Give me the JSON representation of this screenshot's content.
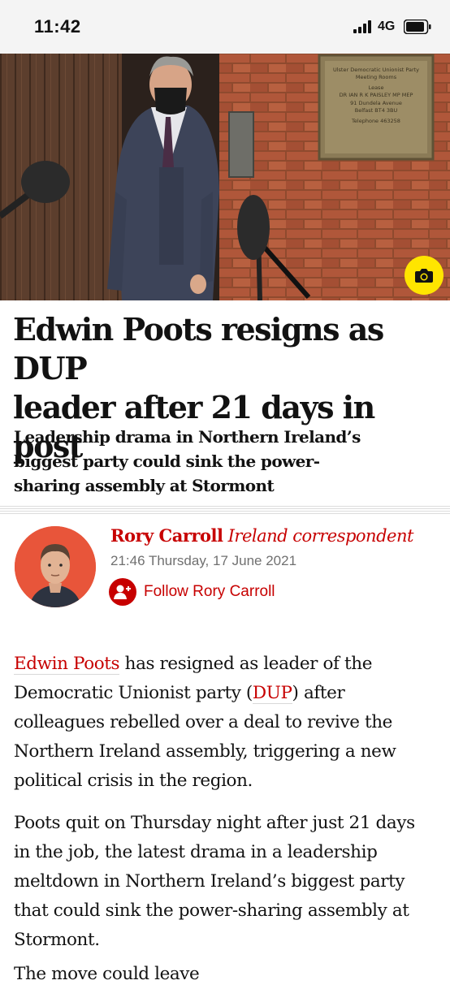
{
  "status_bar": {
    "time": "11:42",
    "network": "4G"
  },
  "hero": {
    "plaque_lines": [
      "Ulster Democratic Unionist Party",
      "Meeting Rooms",
      "Lease",
      "DR IAN R K PAISLEY MP MEP",
      "91 Dundela Avenue",
      "Belfast BT4 3BU",
      "Telephone 463258"
    ]
  },
  "article": {
    "headline_line1": "Edwin Poots resigns as DUP",
    "headline_line2": "leader after 21 days in post",
    "standfirst_line1": "Leadership drama in Northern Ireland’s",
    "standfirst_line2": "biggest party could sink the power-",
    "standfirst_line3": "sharing assembly at Stormont"
  },
  "byline": {
    "author": "Rory Carroll",
    "role": "Ireland correspondent",
    "dateline": "21:46 Thursday, 17 June 2021",
    "follow_label": "Follow Rory Carroll"
  },
  "body": {
    "p1_link1": "Edwin Poots",
    "p1_line1_rest": " has resigned as leader of the",
    "p1_line2_start": "Democratic Unionist party (",
    "p1_link2": "DUP",
    "p1_line2_end": ") after",
    "p1_line3": "colleagues rebelled over a deal to revive the",
    "p1_line4": "Northern Ireland assembly, triggering a new",
    "p1_line5": "political crisis in the region.",
    "p2_line1": "Poots quit on Thursday night after just 21 days",
    "p2_line2": "in the job, the latest drama in a leadership",
    "p2_line3": "meltdown in Northern Ireland’s biggest party",
    "p2_line4": "that could sink the power-sharing assembly at",
    "p2_line5": "Stormont.",
    "p3_line1": "The move could leave"
  },
  "colors": {
    "accent": "#c70000",
    "camera_button": "#ffe500",
    "avatar_bg": "#e8553a"
  },
  "icons": [
    "signal-icon",
    "battery-icon",
    "camera-icon",
    "follow-plus-icon"
  ]
}
